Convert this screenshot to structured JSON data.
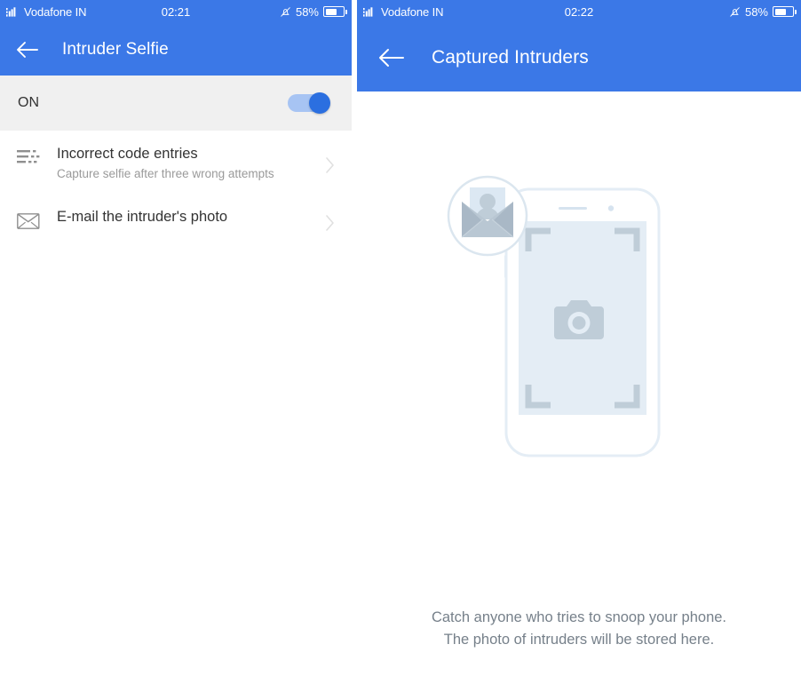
{
  "colors": {
    "brand_blue": "#3b78e7",
    "toggle_thumb": "#2b6fe0",
    "toggle_track": "#a7c4f3",
    "row_bg": "#f0f0f0",
    "illustration_light": "#e4edf5",
    "illustration_mid": "#bfcdd8",
    "caption_text": "#76808a"
  },
  "left_screen": {
    "status_bar": {
      "carrier": "Vodafone IN",
      "time": "02:21",
      "battery_percent": "58%",
      "signal_icon": "signal-bars-icon",
      "silent_icon": "bell-muted-icon",
      "battery_icon": "battery-icon"
    },
    "app_bar": {
      "back_icon": "back-arrow-icon",
      "title": "Intruder Selfie"
    },
    "master_toggle": {
      "label": "ON",
      "state": "on"
    },
    "items": [
      {
        "icon": "passcode-entries-icon",
        "title": "Incorrect code entries",
        "subtitle": "Capture selfie after three wrong attempts",
        "chevron": "chevron-right-icon"
      },
      {
        "icon": "envelope-icon",
        "title": "E-mail the intruder's photo",
        "subtitle": "",
        "chevron": "chevron-right-icon"
      }
    ]
  },
  "right_screen": {
    "status_bar": {
      "carrier": "Vodafone IN",
      "time": "02:22",
      "battery_percent": "58%",
      "signal_icon": "signal-bars-icon",
      "silent_icon": "bell-muted-icon",
      "battery_icon": "battery-icon"
    },
    "app_bar": {
      "back_icon": "back-arrow-icon",
      "title": "Captured Intruders"
    },
    "empty_state": {
      "illustration": "phone-with-camera-and-photo-envelope-illustration",
      "caption_line_1": "Catch anyone who tries to snoop your phone.",
      "caption_line_2": "The photo of intruders will be stored here."
    }
  }
}
